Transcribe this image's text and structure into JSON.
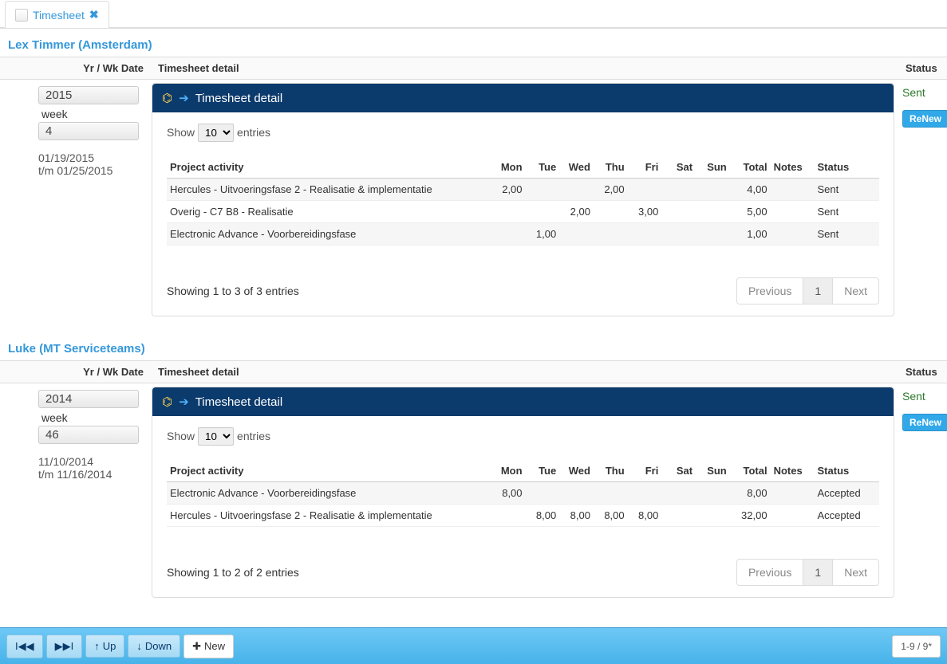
{
  "tab": {
    "label": "Timesheet"
  },
  "headers": {
    "col1": "Yr / Wk Date",
    "col2": "Timesheet detail",
    "col3": "Status"
  },
  "panel_title": "Timesheet detail",
  "show_prefix": "Show",
  "show_suffix": "entries",
  "show_value": "10",
  "dt_headers": {
    "activity": "Project activity",
    "mon": "Mon",
    "tue": "Tue",
    "wed": "Wed",
    "thu": "Thu",
    "fri": "Fri",
    "sat": "Sat",
    "sun": "Sun",
    "total": "Total",
    "notes": "Notes",
    "status": "Status"
  },
  "pager": {
    "prev": "Previous",
    "next": "Next",
    "page": "1"
  },
  "records": [
    {
      "user": "Lex Timmer (Amsterdam)",
      "year": "2015",
      "week_label": "week",
      "week": "4",
      "date_from": "01/19/2015",
      "date_to": "t/m 01/25/2015",
      "status": "Sent",
      "renew": "ReNew",
      "showing": "Showing 1 to 3 of 3 entries",
      "rows": [
        {
          "activity": "Hercules - Uitvoeringsfase 2 - Realisatie & implementatie",
          "mon": "2,00",
          "tue": "",
          "wed": "",
          "thu": "2,00",
          "fri": "",
          "sat": "",
          "sun": "",
          "total": "4,00",
          "notes": "",
          "status": "Sent"
        },
        {
          "activity": "Overig - C7 B8 - Realisatie",
          "mon": "",
          "tue": "",
          "wed": "2,00",
          "thu": "",
          "fri": "3,00",
          "sat": "",
          "sun": "",
          "total": "5,00",
          "notes": "",
          "status": "Sent"
        },
        {
          "activity": "Electronic Advance - Voorbereidingsfase",
          "mon": "",
          "tue": "1,00",
          "wed": "",
          "thu": "",
          "fri": "",
          "sat": "",
          "sun": "",
          "total": "1,00",
          "notes": "",
          "status": "Sent"
        }
      ]
    },
    {
      "user": "Luke (MT Serviceteams)",
      "year": "2014",
      "week_label": "week",
      "week": "46",
      "date_from": "11/10/2014",
      "date_to": "t/m 11/16/2014",
      "status": "Sent",
      "renew": "ReNew",
      "showing": "Showing 1 to 2 of 2 entries",
      "rows": [
        {
          "activity": "Electronic Advance - Voorbereidingsfase",
          "mon": "8,00",
          "tue": "",
          "wed": "",
          "thu": "",
          "fri": "",
          "sat": "",
          "sun": "",
          "total": "8,00",
          "notes": "",
          "status": "Accepted"
        },
        {
          "activity": "Hercules - Uitvoeringsfase 2 - Realisatie & implementatie",
          "mon": "",
          "tue": "8,00",
          "wed": "8,00",
          "thu": "8,00",
          "fri": "8,00",
          "sat": "",
          "sun": "",
          "total": "32,00",
          "notes": "",
          "status": "Accepted"
        }
      ]
    }
  ],
  "bottom": {
    "up": "Up",
    "down": "Down",
    "new": "New",
    "counter": "1-9 / 9*"
  }
}
